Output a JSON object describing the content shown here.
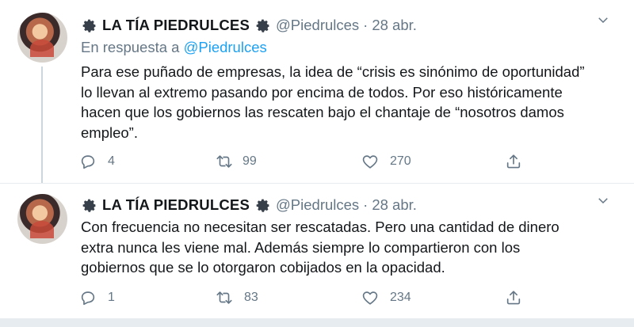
{
  "tweets": [
    {
      "display_name": "LA TÍA PIEDRULCES",
      "handle": "@Piedrulces",
      "separator": "·",
      "date": "28 abr.",
      "reply_prefix": "En respuesta a",
      "reply_mention": "@Piedrulces",
      "text_lines": [
        "Para ese puñado de empresas, la idea de “crisis es sinónimo de oportunidad”",
        "lo llevan al extremo pasando por encima de todos. Por eso históricamente",
        "hacen que los gobiernos las rescaten bajo el chantaje de “nosotros damos",
        "empleo”."
      ],
      "replies": "4",
      "retweets": "99",
      "likes": "270",
      "icons": [
        "gear-icon",
        "chevron-down-icon",
        "reply-icon",
        "retweet-icon",
        "heart-icon",
        "share-icon"
      ]
    },
    {
      "display_name": "LA TÍA PIEDRULCES",
      "handle": "@Piedrulces",
      "separator": "·",
      "date": "28 abr.",
      "text_lines": [
        "Con frecuencia no necesitan ser rescatadas. Pero una cantidad de dinero",
        "extra nunca les viene mal. Además siempre lo compartieron con los",
        "gobiernos que se lo otorgaron cobijados en la opacidad."
      ],
      "replies": "1",
      "retweets": "83",
      "likes": "234",
      "icons": [
        "gear-icon",
        "chevron-down-icon",
        "reply-icon",
        "retweet-icon",
        "heart-icon",
        "share-icon"
      ]
    }
  ],
  "colors": {
    "text": "#14171a",
    "muted": "#657786",
    "link": "#1da1f2",
    "divider": "#e6ecf0"
  }
}
